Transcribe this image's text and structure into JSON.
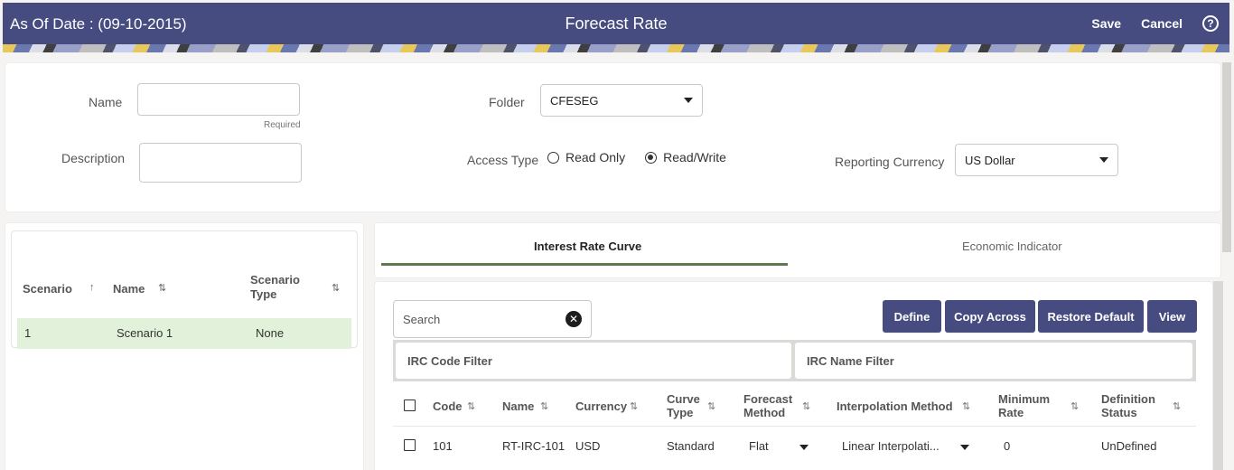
{
  "header": {
    "as_of_date": "As Of Date : (09-10-2015)",
    "title": "Forecast Rate",
    "save_label": "Save",
    "cancel_label": "Cancel",
    "help_icon": "?"
  },
  "form": {
    "name_label": "Name",
    "name_value": "",
    "name_hint": "Required",
    "description_label": "Description",
    "description_value": "",
    "folder_label": "Folder",
    "folder_value": "CFESEG",
    "access_type_label": "Access Type",
    "access_options": [
      {
        "label": "Read Only",
        "selected": false
      },
      {
        "label": "Read/Write",
        "selected": true
      }
    ],
    "reporting_currency_label": "Reporting Currency",
    "reporting_currency_value": "US Dollar"
  },
  "scenarios": {
    "columns": [
      "Scenario",
      "Name",
      "Scenario Type"
    ],
    "sort_icons": [
      "↑",
      "⇅",
      "⇅"
    ],
    "rows": [
      {
        "scenario": "1",
        "name": "Scenario 1",
        "type": "None"
      }
    ]
  },
  "tabs": [
    {
      "label": "Interest Rate Curve",
      "active": true
    },
    {
      "label": "Economic Indicator",
      "active": false
    }
  ],
  "grid": {
    "search_placeholder": "Search",
    "buttons": [
      "Define",
      "Copy Across",
      "Restore Default",
      "View"
    ],
    "filters": [
      "IRC Code Filter",
      "IRC Name Filter"
    ],
    "columns": [
      "Code",
      "Name",
      "Currency",
      "Curve Type",
      "Forecast Method",
      "Interpolation Method",
      "Minimum Rate",
      "Definition Status"
    ],
    "column_lines": {
      "curve_type": [
        "Curve",
        "Type"
      ],
      "forecast_method": [
        "Forecast",
        "Method"
      ],
      "minimum_rate": [
        "Minimum",
        "Rate"
      ],
      "definition_status": [
        "Definition",
        "Status"
      ]
    },
    "sort_icon": "⇅",
    "rows": [
      {
        "code": "101",
        "name": "RT-IRC-101",
        "currency": "USD",
        "curve_type": "Standard",
        "forecast_method": "Flat",
        "interpolation_method": "Linear Interpolati...",
        "minimum_rate": "0",
        "definition_status": "UnDefined"
      }
    ]
  },
  "colors": {
    "header_bg": "#474c80",
    "button_bg": "#474c80",
    "selected_row": "#e2f1da",
    "tab_underline": "#5d7a4e"
  }
}
